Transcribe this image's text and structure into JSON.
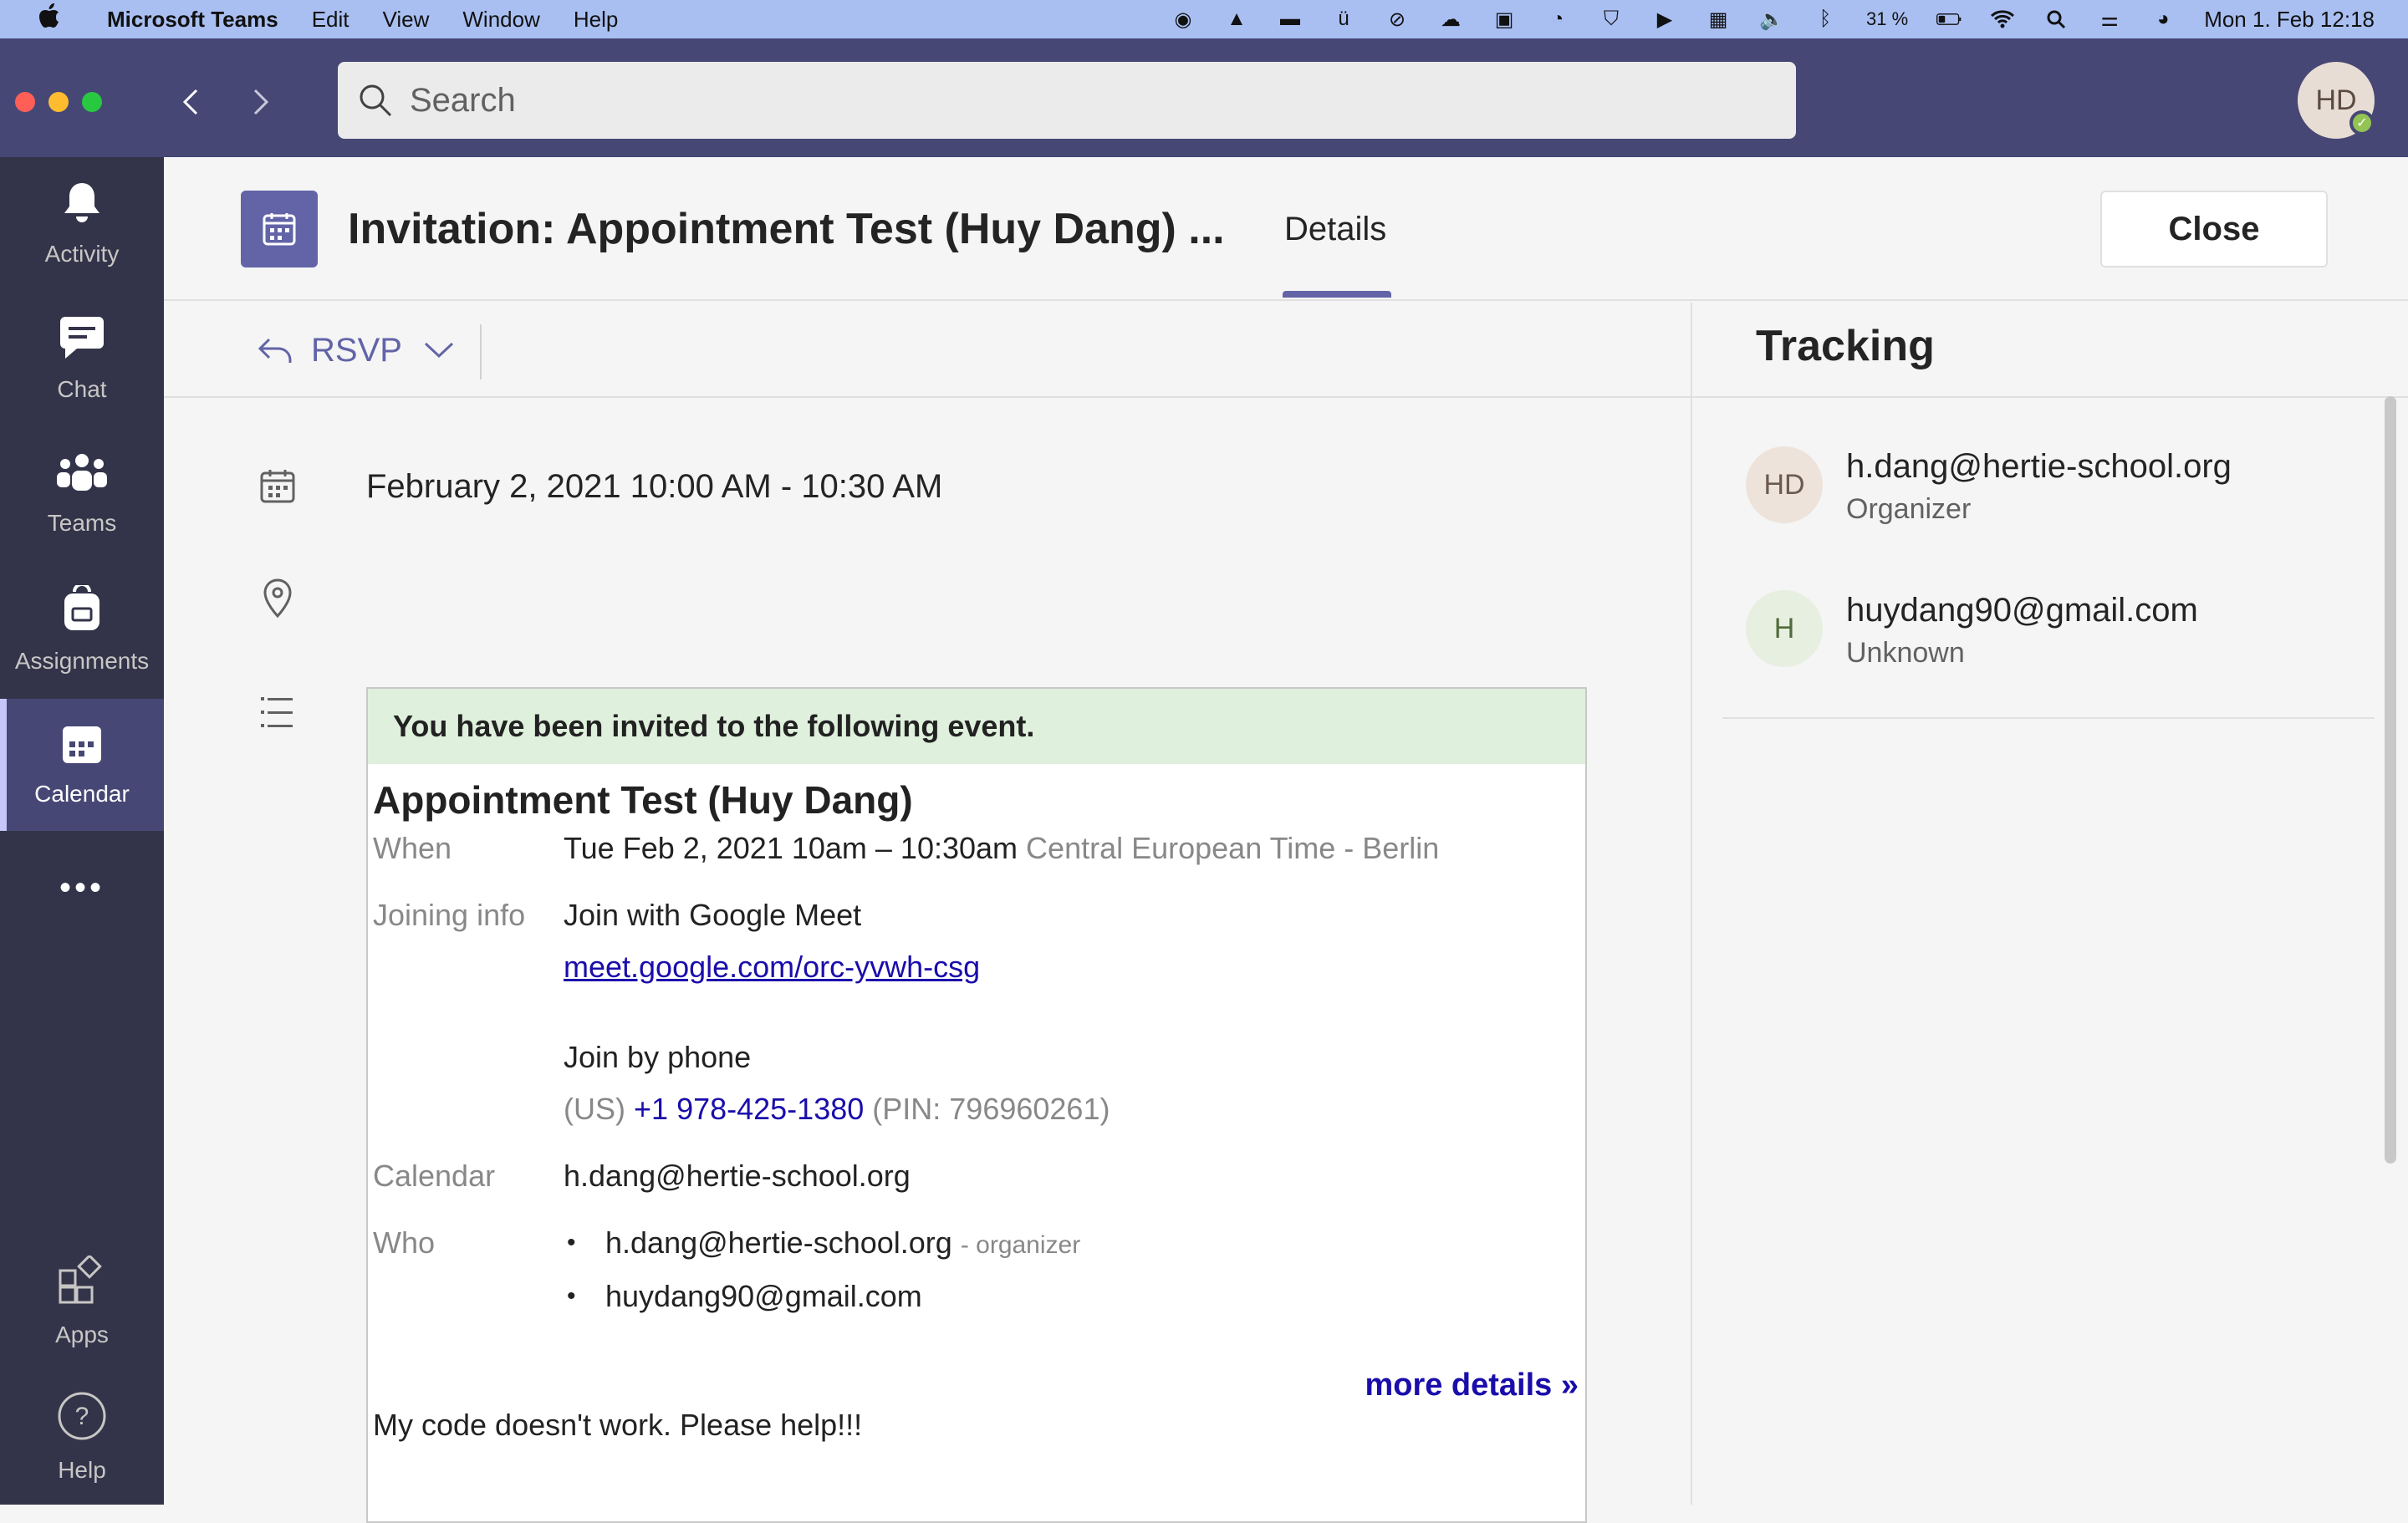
{
  "menubar": {
    "apple": "",
    "items": [
      "Microsoft Teams",
      "Edit",
      "View",
      "Window",
      "Help"
    ],
    "battery": "31 %",
    "datetime": "Mon 1. Feb  12:18"
  },
  "search": {
    "placeholder": "Search"
  },
  "user": {
    "initials": "HD"
  },
  "rail": [
    {
      "label": "Activity",
      "icon": "bell-icon"
    },
    {
      "label": "Chat",
      "icon": "chat-icon"
    },
    {
      "label": "Teams",
      "icon": "teams-icon"
    },
    {
      "label": "Assignments",
      "icon": "backpack-icon"
    },
    {
      "label": "Calendar",
      "icon": "calendar-icon"
    },
    {
      "label": "•••",
      "icon": "more-icon"
    },
    {
      "label": "Apps",
      "icon": "apps-icon"
    },
    {
      "label": "Help",
      "icon": "help-icon"
    }
  ],
  "header": {
    "title": "Invitation: Appointment Test (Huy Dang) ...",
    "tab": "Details",
    "close": "Close"
  },
  "toolbar": {
    "rsvp": "RSVP"
  },
  "event": {
    "datetime": "February 2, 2021 10:00 AM - 10:30 AM",
    "banner": "You have been invited to the following event.",
    "title": "Appointment Test (Huy Dang)",
    "when_label": "When",
    "when_value": "Tue Feb 2, 2021 10am – 10:30am",
    "when_tz": "Central European Time - Berlin",
    "joining_label": "Joining info",
    "join_meet": "Join with Google Meet",
    "meet_link": "meet.google.com/orc-yvwh-csg",
    "join_phone": "Join by phone",
    "phone_prefix": "(US)",
    "phone_number": "+1 978-425-1380",
    "phone_pin": "(PIN: 796960261)",
    "calendar_label": "Calendar",
    "calendar_value": "h.dang@hertie-school.org",
    "who_label": "Who",
    "who": [
      {
        "email": "h.dang@hertie-school.org",
        "note": "- organizer"
      },
      {
        "email": "huydang90@gmail.com",
        "note": ""
      }
    ],
    "more_details": "more details »",
    "description": "My code doesn't work. Please help!!!"
  },
  "tracking": {
    "title": "Tracking",
    "people": [
      {
        "initials": "HD",
        "email": "h.dang@hertie-school.org",
        "role": "Organizer",
        "color": "#ede3db"
      },
      {
        "initials": "H",
        "email": "huydang90@gmail.com",
        "role": "Unknown",
        "color": "#e7efe0"
      }
    ]
  }
}
